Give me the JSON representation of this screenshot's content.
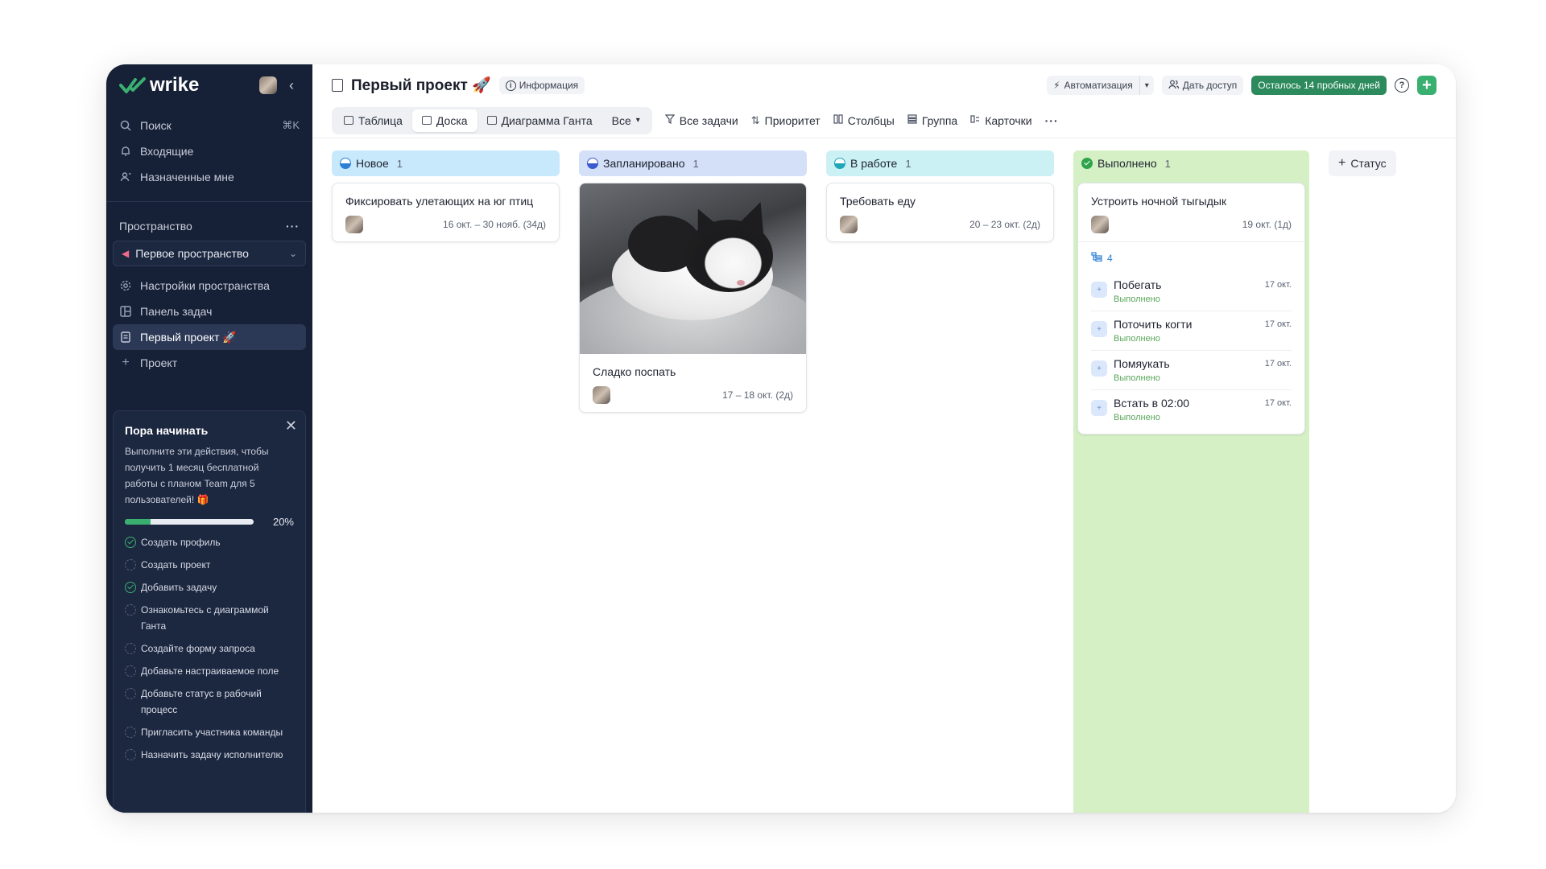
{
  "sidebar": {
    "logo": "wrike",
    "nav": [
      {
        "label": "Поиск",
        "kbd": "⌘K",
        "icon": "search-icon"
      },
      {
        "label": "Входящие",
        "icon": "bell-icon"
      },
      {
        "label": "Назначенные мне",
        "icon": "assignee-icon"
      }
    ],
    "space_section": "Пространство",
    "space_name": "Первое пространство",
    "space_items": [
      {
        "label": "Настройки пространства",
        "icon": "gear-icon"
      },
      {
        "label": "Панель задач",
        "icon": "dashboard-icon"
      },
      {
        "label": "Первый проект 🚀",
        "icon": "doc-icon",
        "active": true
      },
      {
        "label": "Проект",
        "icon": "plus-icon"
      }
    ],
    "promo": {
      "title": "Пора начинать",
      "text": "Выполните эти действия, чтобы получить 1 месяц бесплатной работы с планом Team для 5 пользователей! 🎁",
      "progress_pct": "20%",
      "progress_value": 0.2,
      "checklist": [
        {
          "label": "Создать профиль",
          "done": true
        },
        {
          "label": "Создать проект",
          "done": false
        },
        {
          "label": "Добавить задачу",
          "done": true
        },
        {
          "label": "Ознакомьтесь с диаграммой Ганта",
          "done": false
        },
        {
          "label": "Создайте форму запроса",
          "done": false
        },
        {
          "label": "Добавьте настраиваемое поле",
          "done": false
        },
        {
          "label": "Добавьте статус в рабочий процесс",
          "done": false
        },
        {
          "label": "Пригласить участника команды",
          "done": false
        },
        {
          "label": "Назначить задачу исполнителю",
          "done": false
        }
      ]
    }
  },
  "header": {
    "title": "Первый проект 🚀",
    "info": "Информация",
    "automation": "Автоматизация",
    "share": "Дать доступ",
    "trial": "Осталось 14 пробных дней"
  },
  "toolbar": {
    "views": [
      {
        "label": "Таблица",
        "active": false
      },
      {
        "label": "Доска",
        "active": true
      },
      {
        "label": "Диаграмма Ганта",
        "active": false
      },
      {
        "label": "Все",
        "active": false
      }
    ],
    "tools": [
      "Все задачи",
      "Приоритет",
      "Столбцы",
      "Группа",
      "Карточки"
    ]
  },
  "board": {
    "columns": [
      {
        "name": "Новое",
        "count": "1",
        "color": "#c8e8fb",
        "cards": [
          {
            "title": "Фиксировать улетающих на юг птиц",
            "date": "16 окт. – 30 нояб. (34д)"
          }
        ]
      },
      {
        "name": "Запланировано",
        "count": "1",
        "color": "#d3e0f7",
        "cards": [
          {
            "title": "Сладко поспать",
            "date": "17 – 18 окт. (2д)",
            "has_image": true
          }
        ]
      },
      {
        "name": "В работе",
        "count": "1",
        "color": "#cbf1f4",
        "cards": [
          {
            "title": "Требовать еду",
            "date": "20 – 23 окт. (2д)"
          }
        ]
      },
      {
        "name": "Выполнено",
        "count": "1",
        "color": "#d4f0c4",
        "cards": [
          {
            "title": "Устроить ночной тыгыдык",
            "date": "19 окт. (1д)",
            "subtask_count": "4",
            "subtasks": [
              {
                "name": "Побегать",
                "status": "Выполнено",
                "date": "17 окт."
              },
              {
                "name": "Поточить когти",
                "status": "Выполнено",
                "date": "17 окт."
              },
              {
                "name": "Помяукать",
                "status": "Выполнено",
                "date": "17 окт."
              },
              {
                "name": "Встать в 02:00",
                "status": "Выполнено",
                "date": "17 окт."
              }
            ]
          }
        ]
      }
    ],
    "add_status": "Статус"
  }
}
